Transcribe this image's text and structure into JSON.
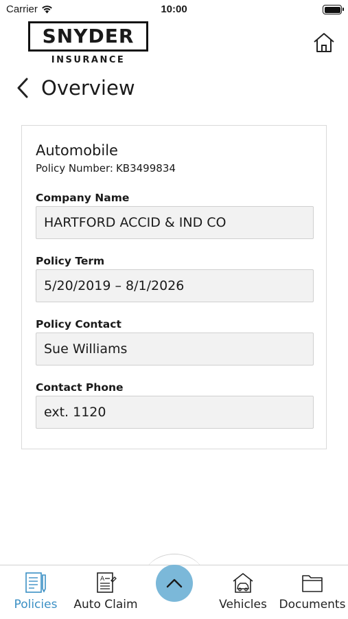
{
  "status_bar": {
    "carrier": "Carrier",
    "time": "10:00"
  },
  "header": {
    "logo_main": "SNYDER",
    "logo_sub": "INSURANCE",
    "page_title": "Overview"
  },
  "policy": {
    "type": "Automobile",
    "number_label": "Policy Number:",
    "number_value": "KB3499834",
    "fields": [
      {
        "label": "Company Name",
        "value": "HARTFORD ACCID & IND CO"
      },
      {
        "label": "Policy Term",
        "value": "5/20/2019 – 8/1/2026"
      },
      {
        "label": "Policy Contact",
        "value": "Sue Williams"
      },
      {
        "label": "Contact Phone",
        "value": "ext. 1120"
      }
    ]
  },
  "tab_bar": {
    "tabs": [
      {
        "label": "Policies",
        "icon": "policies-icon",
        "active": true
      },
      {
        "label": "Auto Claim",
        "icon": "auto-claim-icon",
        "active": false
      },
      {
        "label": "Vehicles",
        "icon": "vehicles-icon",
        "active": false
      },
      {
        "label": "Documents",
        "icon": "documents-icon",
        "active": false
      }
    ],
    "fab_icon": "chevron-up-icon"
  },
  "colors": {
    "accent": "#3a8fc4",
    "fab": "#7bb8d9",
    "field_bg": "#f2f2f2"
  }
}
